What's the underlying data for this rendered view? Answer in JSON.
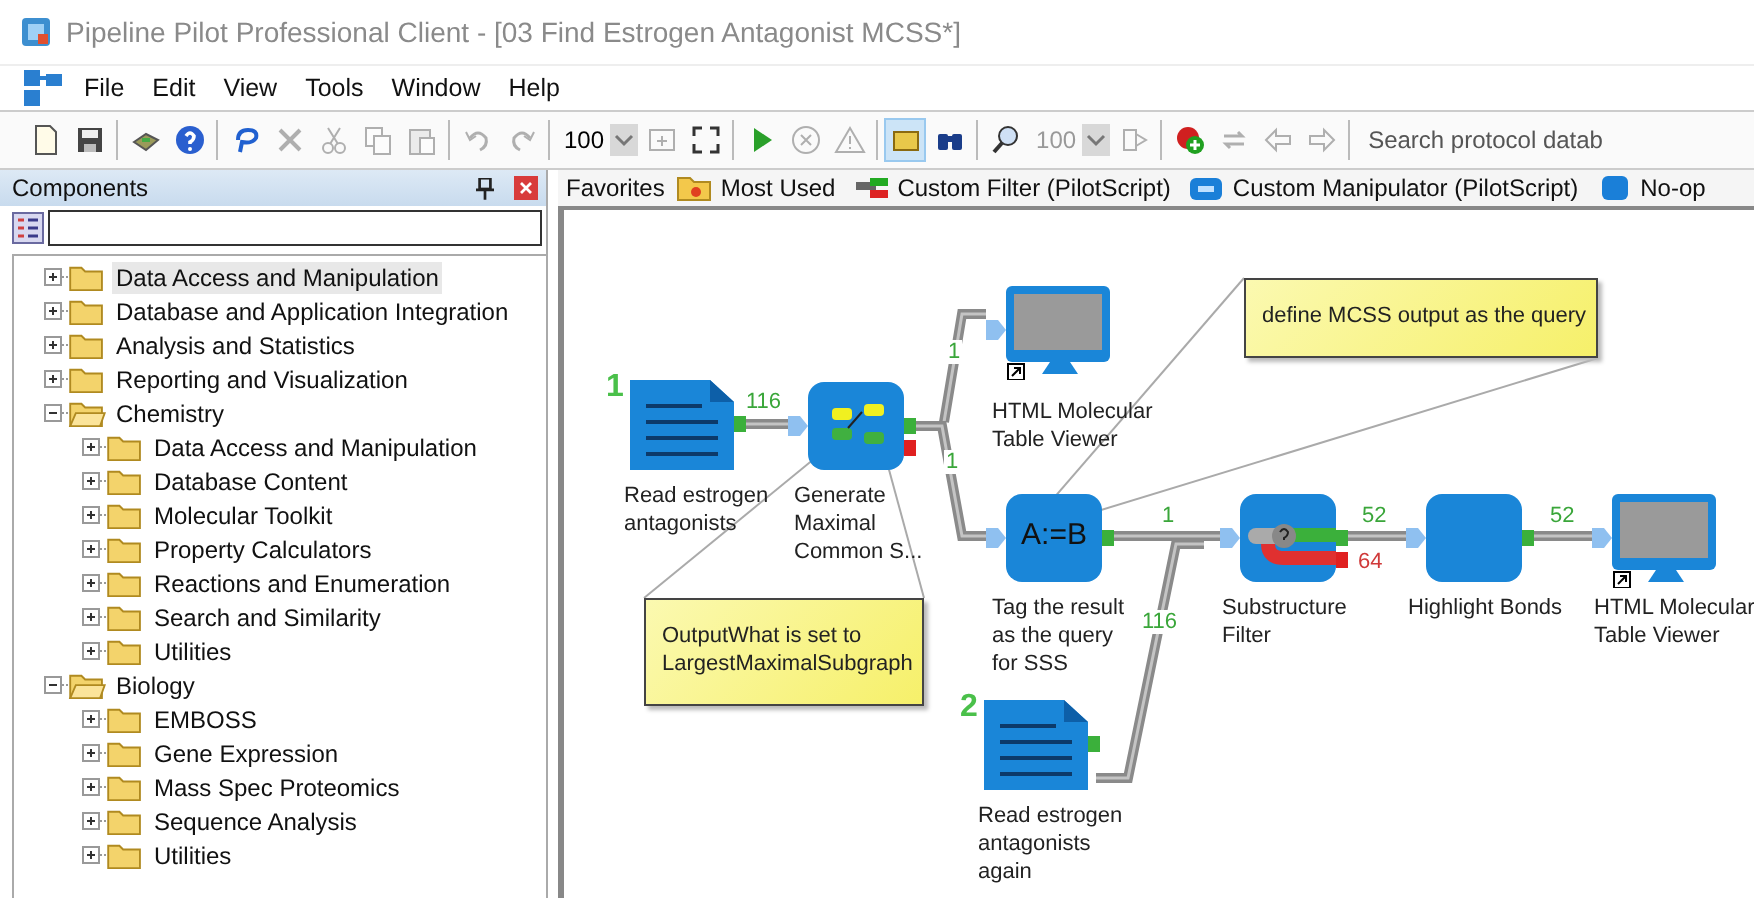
{
  "window": {
    "title": "Pipeline Pilot Professional Client - [03 Find Estrogen Antagonist MCSS*]"
  },
  "menu": [
    "File",
    "Edit",
    "View",
    "Tools",
    "Window",
    "Help"
  ],
  "toolbar": [
    {
      "kind": "new",
      "disabled": false
    },
    {
      "kind": "save",
      "disabled": false
    },
    {
      "kind": "separator"
    },
    {
      "kind": "package",
      "disabled": false
    },
    {
      "kind": "help",
      "disabled": false
    },
    {
      "kind": "separator"
    },
    {
      "kind": "lasso",
      "disabled": false
    },
    {
      "kind": "delete",
      "disabled": true
    },
    {
      "kind": "cut",
      "disabled": true
    },
    {
      "kind": "copy",
      "disabled": true
    },
    {
      "kind": "paste",
      "disabled": true
    },
    {
      "kind": "separator"
    },
    {
      "kind": "undo",
      "disabled": true
    },
    {
      "kind": "redo",
      "disabled": true
    },
    {
      "kind": "separator"
    },
    {
      "kind": "zoom",
      "value": "100",
      "disabled": false
    },
    {
      "kind": "fit",
      "disabled": true
    },
    {
      "kind": "expand",
      "disabled": false
    },
    {
      "kind": "separator"
    },
    {
      "kind": "run",
      "disabled": false
    },
    {
      "kind": "stop",
      "disabled": true
    },
    {
      "kind": "warning",
      "disabled": true
    },
    {
      "kind": "separator"
    },
    {
      "kind": "panel",
      "disabled": false,
      "on": true
    },
    {
      "kind": "find",
      "disabled": false,
      "on": false
    },
    {
      "kind": "separator"
    },
    {
      "kind": "magnifier",
      "disabled": false
    },
    {
      "kind": "zoom",
      "value": "100",
      "disabled": true
    },
    {
      "kind": "export",
      "disabled": true
    },
    {
      "kind": "separator"
    },
    {
      "kind": "add",
      "disabled": false
    },
    {
      "kind": "sync",
      "disabled": true
    },
    {
      "kind": "back",
      "disabled": true
    },
    {
      "kind": "forward",
      "disabled": true
    },
    {
      "kind": "separator"
    },
    {
      "kind": "search",
      "placeholder": "Search protocol datab"
    }
  ],
  "components": {
    "title": "Components",
    "tree": [
      {
        "label": "Data Access and Manipulation",
        "expanded": false,
        "selected": true
      },
      {
        "label": "Database and Application Integration",
        "expanded": false,
        "selected": false
      },
      {
        "label": "Analysis and Statistics",
        "expanded": false,
        "selected": false
      },
      {
        "label": "Reporting and Visualization",
        "expanded": false,
        "selected": false
      },
      {
        "label": "Chemistry",
        "expanded": true,
        "selected": false,
        "children": [
          {
            "label": "Data Access and Manipulation",
            "expanded": false,
            "selected": false
          },
          {
            "label": "Database Content",
            "expanded": false,
            "selected": false
          },
          {
            "label": "Molecular Toolkit",
            "expanded": false,
            "selected": false
          },
          {
            "label": "Property Calculators",
            "expanded": false,
            "selected": false
          },
          {
            "label": "Reactions and Enumeration",
            "expanded": false,
            "selected": false
          },
          {
            "label": "Search and Similarity",
            "expanded": false,
            "selected": false
          },
          {
            "label": "Utilities",
            "expanded": false,
            "selected": false
          }
        ]
      },
      {
        "label": "Biology",
        "expanded": true,
        "selected": false,
        "children": [
          {
            "label": "EMBOSS",
            "expanded": false,
            "selected": false
          },
          {
            "label": "Gene Expression",
            "expanded": false,
            "selected": false
          },
          {
            "label": "Mass Spec Proteomics",
            "expanded": false,
            "selected": false
          },
          {
            "label": "Sequence Analysis",
            "expanded": false,
            "selected": false
          },
          {
            "label": "Utilities",
            "expanded": false,
            "selected": false
          }
        ]
      }
    ]
  },
  "favorites": {
    "label": "Favorites",
    "items": [
      {
        "label": "Most Used",
        "kind": "folder"
      },
      {
        "label": "Custom Filter (PilotScript)",
        "kind": "filter"
      },
      {
        "label": "Custom Manipulator (PilotScript)",
        "kind": "manipulator"
      },
      {
        "label": "No-op",
        "kind": "noop"
      }
    ]
  },
  "canvas": {
    "nodes": [
      {
        "kind": "reader",
        "label": "Read estrogen\nantagonists",
        "number": "1"
      },
      {
        "kind": "mcss",
        "label": "Generate\nMaximal\nCommon S..."
      },
      {
        "kind": "viewer",
        "label": "HTML Molecular\nTable Viewer"
      },
      {
        "kind": "tagger",
        "label": "Tag the result\nas the query\nfor SSS",
        "glyph": "A:=B"
      },
      {
        "kind": "filter",
        "label": "Substructure\nFilter"
      },
      {
        "kind": "plain",
        "label": "Highlight Bonds"
      },
      {
        "kind": "viewer",
        "label": "HTML Molecular\nTable Viewer"
      },
      {
        "kind": "reader",
        "label": "Read estrogen\nantagonists\nagain",
        "number": "2"
      }
    ],
    "counts": [
      {
        "text": "116",
        "kind": "pass"
      },
      {
        "text": "1",
        "kind": "pass"
      },
      {
        "text": "1",
        "kind": "pass"
      },
      {
        "text": "1",
        "kind": "pass"
      },
      {
        "text": "116",
        "kind": "pass"
      },
      {
        "text": "52",
        "kind": "pass"
      },
      {
        "text": "64",
        "kind": "fail"
      },
      {
        "text": "52",
        "kind": "pass"
      }
    ],
    "notes": [
      "OutputWhat is set to\nLargestMaximalSubgraph",
      "define MCSS output as the query"
    ]
  }
}
